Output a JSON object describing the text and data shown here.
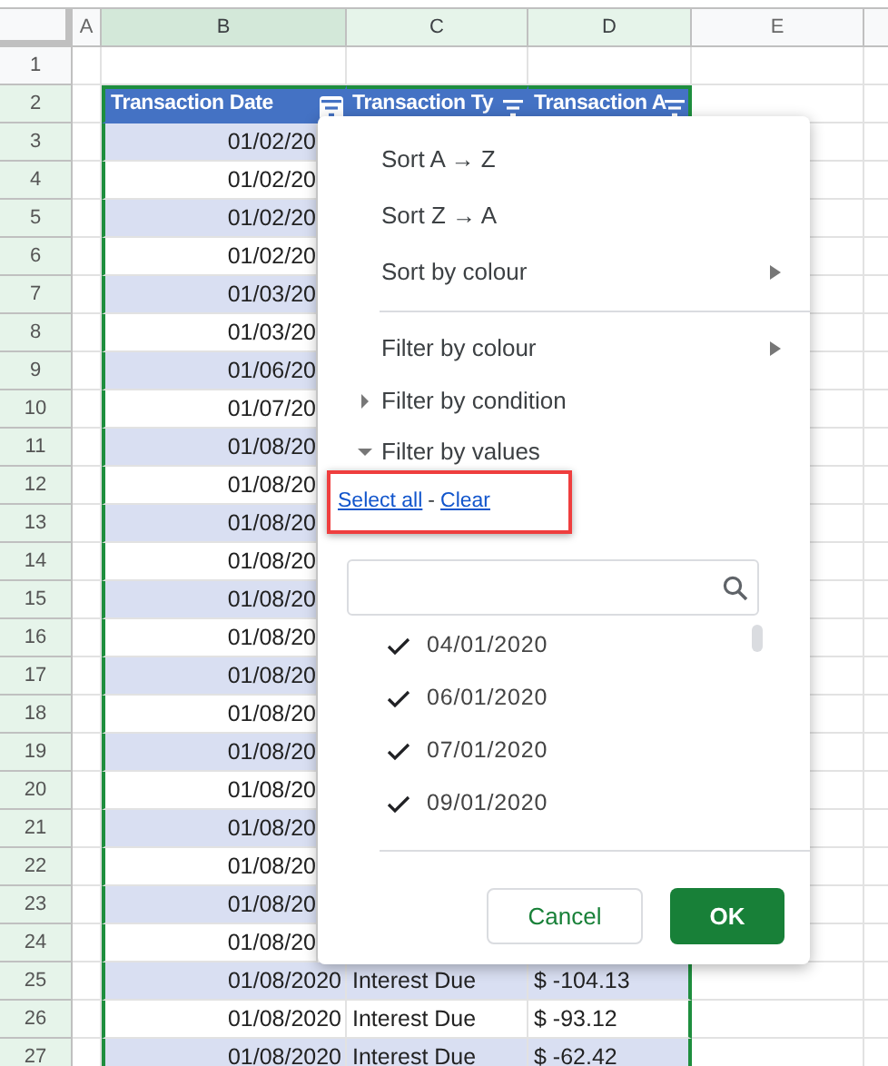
{
  "column_headers": [
    {
      "label": "A",
      "selected": false,
      "in_selection": false
    },
    {
      "label": "B",
      "selected": true,
      "in_selection": true
    },
    {
      "label": "C",
      "selected": false,
      "in_selection": true
    },
    {
      "label": "D",
      "selected": false,
      "in_selection": true
    },
    {
      "label": "E",
      "selected": false,
      "in_selection": false
    }
  ],
  "rows": [
    {
      "number": "1",
      "highlighted": false,
      "kind": "blank",
      "cells": []
    },
    {
      "number": "2",
      "highlighted": true,
      "kind": "header",
      "cells": [
        {
          "text": "Transaction Date",
          "filter_open": true
        },
        {
          "text": "Transaction Ty",
          "filter_open": false
        },
        {
          "text": "Transaction A",
          "filter_open": false
        }
      ]
    },
    {
      "number": "3",
      "highlighted": true,
      "kind": "data",
      "banded": true,
      "cells": [
        "01/02/20"
      ]
    },
    {
      "number": "4",
      "highlighted": true,
      "kind": "data",
      "banded": false,
      "cells": [
        "01/02/20"
      ]
    },
    {
      "number": "5",
      "highlighted": true,
      "kind": "data",
      "banded": true,
      "cells": [
        "01/02/20"
      ]
    },
    {
      "number": "6",
      "highlighted": true,
      "kind": "data",
      "banded": false,
      "cells": [
        "01/02/20"
      ]
    },
    {
      "number": "7",
      "highlighted": true,
      "kind": "data",
      "banded": true,
      "cells": [
        "01/03/20"
      ]
    },
    {
      "number": "8",
      "highlighted": true,
      "kind": "data",
      "banded": false,
      "cells": [
        "01/03/20"
      ]
    },
    {
      "number": "9",
      "highlighted": true,
      "kind": "data",
      "banded": true,
      "cells": [
        "01/06/20"
      ]
    },
    {
      "number": "10",
      "highlighted": true,
      "kind": "data",
      "banded": false,
      "cells": [
        "01/07/20"
      ]
    },
    {
      "number": "11",
      "highlighted": true,
      "kind": "data",
      "banded": true,
      "cells": [
        "01/08/20"
      ]
    },
    {
      "number": "12",
      "highlighted": true,
      "kind": "data",
      "banded": false,
      "cells": [
        "01/08/20"
      ]
    },
    {
      "number": "13",
      "highlighted": true,
      "kind": "data",
      "banded": true,
      "cells": [
        "01/08/20"
      ]
    },
    {
      "number": "14",
      "highlighted": true,
      "kind": "data",
      "banded": false,
      "cells": [
        "01/08/20"
      ]
    },
    {
      "number": "15",
      "highlighted": true,
      "kind": "data",
      "banded": true,
      "cells": [
        "01/08/20"
      ]
    },
    {
      "number": "16",
      "highlighted": true,
      "kind": "data",
      "banded": false,
      "cells": [
        "01/08/20"
      ]
    },
    {
      "number": "17",
      "highlighted": true,
      "kind": "data",
      "banded": true,
      "cells": [
        "01/08/20"
      ]
    },
    {
      "number": "18",
      "highlighted": true,
      "kind": "data",
      "banded": false,
      "cells": [
        "01/08/20"
      ]
    },
    {
      "number": "19",
      "highlighted": true,
      "kind": "data",
      "banded": true,
      "cells": [
        "01/08/20"
      ]
    },
    {
      "number": "20",
      "highlighted": true,
      "kind": "data",
      "banded": false,
      "cells": [
        "01/08/20"
      ]
    },
    {
      "number": "21",
      "highlighted": true,
      "kind": "data",
      "banded": true,
      "cells": [
        "01/08/20"
      ]
    },
    {
      "number": "22",
      "highlighted": true,
      "kind": "data",
      "banded": false,
      "cells": [
        "01/08/20"
      ]
    },
    {
      "number": "23",
      "highlighted": true,
      "kind": "data",
      "banded": true,
      "cells": [
        "01/08/20"
      ]
    },
    {
      "number": "24",
      "highlighted": true,
      "kind": "data",
      "banded": false,
      "cells": [
        "01/08/20"
      ]
    },
    {
      "number": "25",
      "highlighted": true,
      "kind": "data",
      "banded": true,
      "cells": [
        "01/08/2020",
        "Interest Due",
        "$ -104.13"
      ]
    },
    {
      "number": "26",
      "highlighted": true,
      "kind": "data",
      "banded": false,
      "cells": [
        "01/08/2020",
        "Interest Due",
        "$ -93.12"
      ]
    },
    {
      "number": "27",
      "highlighted": true,
      "kind": "data",
      "banded": true,
      "cells": [
        "01/08/2020",
        "Interest Due",
        "$ -62.42"
      ]
    }
  ],
  "filter_menu": {
    "items": [
      {
        "kind": "item",
        "label": "Sort A → Z"
      },
      {
        "kind": "item",
        "label": "Sort Z → A"
      },
      {
        "kind": "submenu",
        "label": "Sort by colour"
      },
      {
        "kind": "divider"
      },
      {
        "kind": "submenu",
        "label": "Filter by colour"
      },
      {
        "kind": "section",
        "label": "Filter by condition",
        "expanded": false
      },
      {
        "kind": "section",
        "label": "Filter by values",
        "expanded": true
      }
    ],
    "links": {
      "select_all": "Select all",
      "separator": "-",
      "clear": "Clear",
      "highlighted": true
    },
    "values": [
      {
        "label": "04/01/2020",
        "checked": true
      },
      {
        "label": "06/01/2020",
        "checked": true
      },
      {
        "label": "07/01/2020",
        "checked": true
      },
      {
        "label": "09/01/2020",
        "checked": true
      }
    ],
    "buttons": [
      {
        "kind": "secondary",
        "label": "Cancel"
      },
      {
        "kind": "primary",
        "label": "OK"
      }
    ]
  }
}
